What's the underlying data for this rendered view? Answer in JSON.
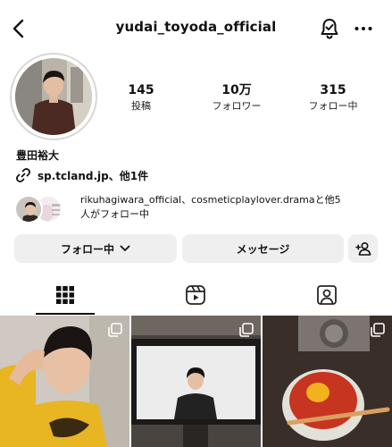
{
  "header": {
    "username": "yudai_toyoda_official",
    "back_icon": "chevron-left-icon",
    "notification_icon": "bell-check-icon",
    "more_icon": "more-horizontal-icon"
  },
  "stats": {
    "posts_count": "145",
    "posts_label": "投稿",
    "followers_count": "10万",
    "followers_label": "フォロワー",
    "following_count": "315",
    "following_label": "フォロー中"
  },
  "profile": {
    "display_name": "豊田裕大",
    "link_text": "sp.tcland.jp、他1件",
    "link_icon": "link-icon",
    "followed_by_line1": "rikuhagiwara_official、cosmeticplaylover.dramaと他5",
    "followed_by_line2": "人がフォロー中"
  },
  "actions": {
    "follow_label": "フォロー中",
    "message_label": "メッセージ",
    "add_person_icon": "add-person-icon"
  },
  "tabs": [
    "grid-icon",
    "reels-icon",
    "tagged-icon"
  ],
  "colors": {
    "button_bg": "#efefef",
    "text": "#111111",
    "avatar_ring": "#d7d7d7"
  }
}
